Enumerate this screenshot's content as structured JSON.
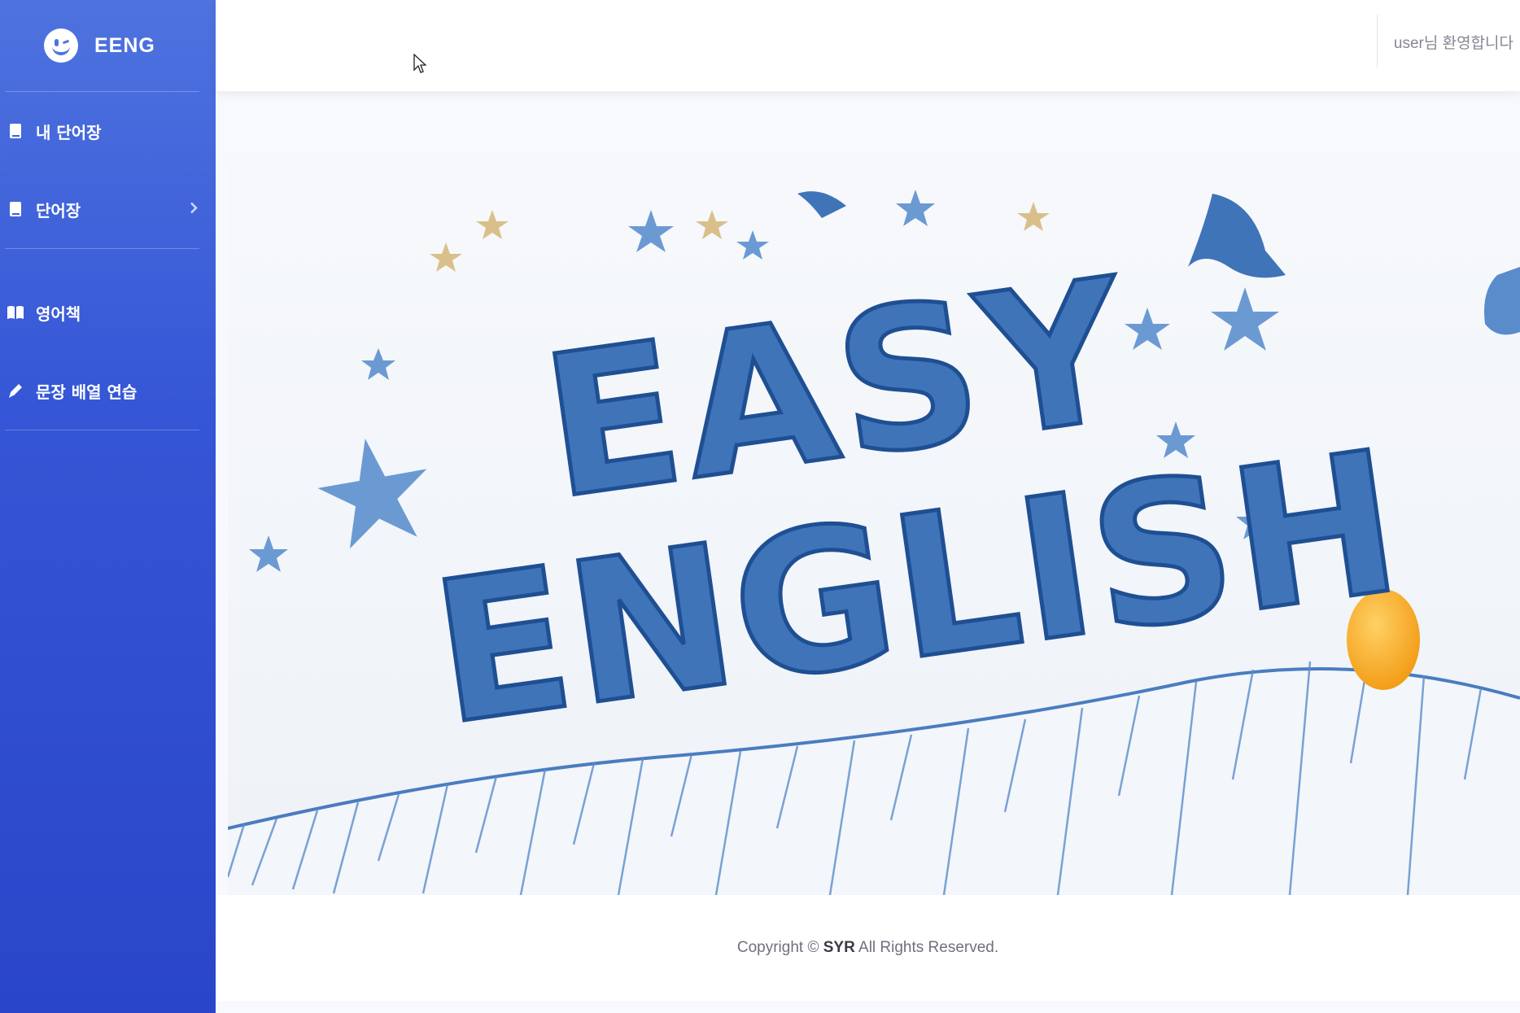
{
  "brand": {
    "name": "EENG",
    "logo_icon": "winking-face-icon"
  },
  "sidebar": {
    "items": [
      {
        "label": "내 단어장",
        "icon": "book-icon"
      },
      {
        "label": "단어장",
        "icon": "book-icon",
        "has_submenu": true
      },
      {
        "label": "영어책",
        "icon": "open-book-icon"
      },
      {
        "label": "문장 배열 연습",
        "icon": "pencil-icon"
      }
    ]
  },
  "topbar": {
    "welcome": "user님 환영합니다"
  },
  "banner": {
    "line1": "EASY",
    "line2": "ENGLISH"
  },
  "footer": {
    "prefix": "Copyright © ",
    "owner": "SYR",
    "suffix": " All Rights Reserved."
  },
  "colors": {
    "sidebar_top": "#4e73df",
    "sidebar_bottom": "#2a45c9",
    "banner_letters": "#3f74b8",
    "sun": "#f5a623"
  }
}
